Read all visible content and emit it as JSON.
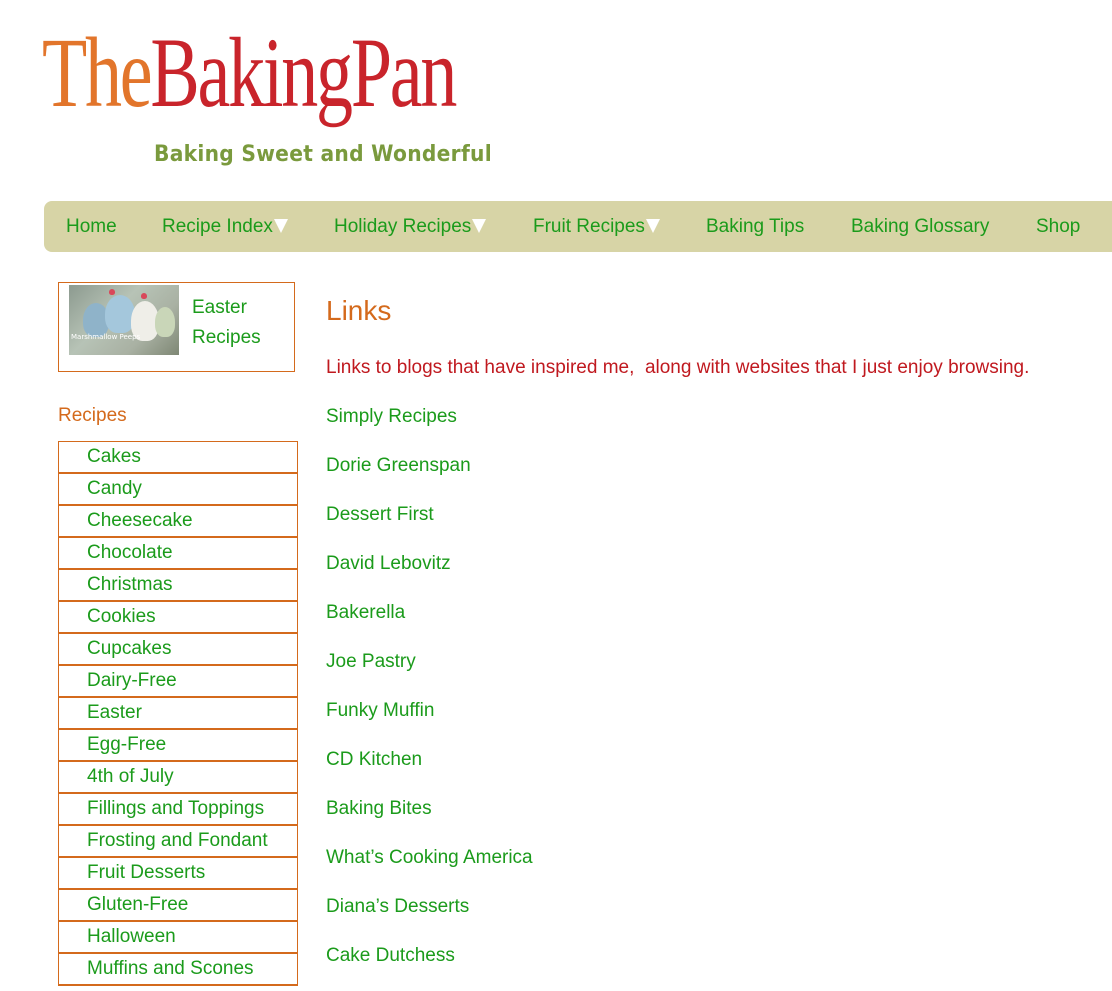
{
  "site": {
    "logo_the": "The",
    "logo_baking_pan": "BakingPan",
    "tagline": "Baking Sweet and Wonderful"
  },
  "nav": {
    "items": [
      {
        "label": "Home",
        "dropdown": false
      },
      {
        "label": "Recipe Index",
        "dropdown": true
      },
      {
        "label": "Holiday Recipes",
        "dropdown": true
      },
      {
        "label": "Fruit Recipes",
        "dropdown": true
      },
      {
        "label": "Baking Tips",
        "dropdown": false
      },
      {
        "label": "Baking Glossary",
        "dropdown": false
      },
      {
        "label": "Shop",
        "dropdown": false
      }
    ]
  },
  "sidebar": {
    "feature": {
      "image_caption": "Marshmallow Peeps",
      "line1": "Easter",
      "line2": "Recipes"
    },
    "section_title": "Recipes",
    "recipes": [
      "Cakes",
      "Candy",
      "Cheesecake",
      "Chocolate",
      "Christmas",
      "Cookies",
      "Cupcakes",
      "Dairy-Free",
      "Easter",
      "Egg-Free",
      "4th of July",
      "Fillings and Toppings",
      "Frosting and Fondant",
      "Fruit Desserts",
      "Gluten-Free",
      "Halloween",
      "Muffins and Scones"
    ]
  },
  "main": {
    "title": "Links",
    "intro": "Links to blogs that have inspired me,  along with websites that I just enjoy browsing.",
    "links": [
      "Simply Recipes",
      "Dorie Greenspan",
      "Dessert First",
      "David Lebovitz",
      "Bakerella",
      "Joe Pastry",
      "Funky Muffin",
      "CD Kitchen",
      "Baking Bites",
      "What’s Cooking America",
      "Diana’s Desserts",
      "Cake Dutchess"
    ]
  },
  "colors": {
    "link_green": "#1b9b1b",
    "accent_orange": "#d46a1c",
    "intro_red": "#c0191f",
    "nav_background": "#d7d4a6",
    "logo_orange": "#e2752b",
    "logo_red": "#c9242b",
    "tagline_green": "#7a9a3d"
  }
}
